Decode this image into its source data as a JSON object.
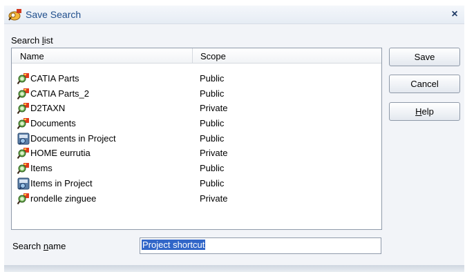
{
  "window": {
    "title": "Save Search",
    "close_glyph": "×"
  },
  "search_list": {
    "label": "Search list",
    "columns": {
      "name": "Name",
      "scope": "Scope"
    },
    "items": [
      {
        "name": "CATIA Parts",
        "scope": "Public",
        "icon": "search-icon"
      },
      {
        "name": "CATIA Parts_2",
        "scope": "Public",
        "icon": "search-icon"
      },
      {
        "name": "D2TAXN",
        "scope": "Private",
        "icon": "search-icon"
      },
      {
        "name": "Documents",
        "scope": "Public",
        "icon": "search-icon"
      },
      {
        "name": "Documents in Project",
        "scope": "Public",
        "icon": "project-search-icon"
      },
      {
        "name": "HOME eurrutia",
        "scope": "Private",
        "icon": "search-icon"
      },
      {
        "name": "Items",
        "scope": "Public",
        "icon": "search-icon"
      },
      {
        "name": "Items in Project",
        "scope": "Public",
        "icon": "project-search-icon"
      },
      {
        "name": "rondelle zinguee",
        "scope": "Private",
        "icon": "search-icon"
      }
    ]
  },
  "buttons": {
    "save": "Save",
    "cancel": "Cancel",
    "help": "Help"
  },
  "search_name": {
    "label": "Search name",
    "value": "Project shortcut"
  }
}
